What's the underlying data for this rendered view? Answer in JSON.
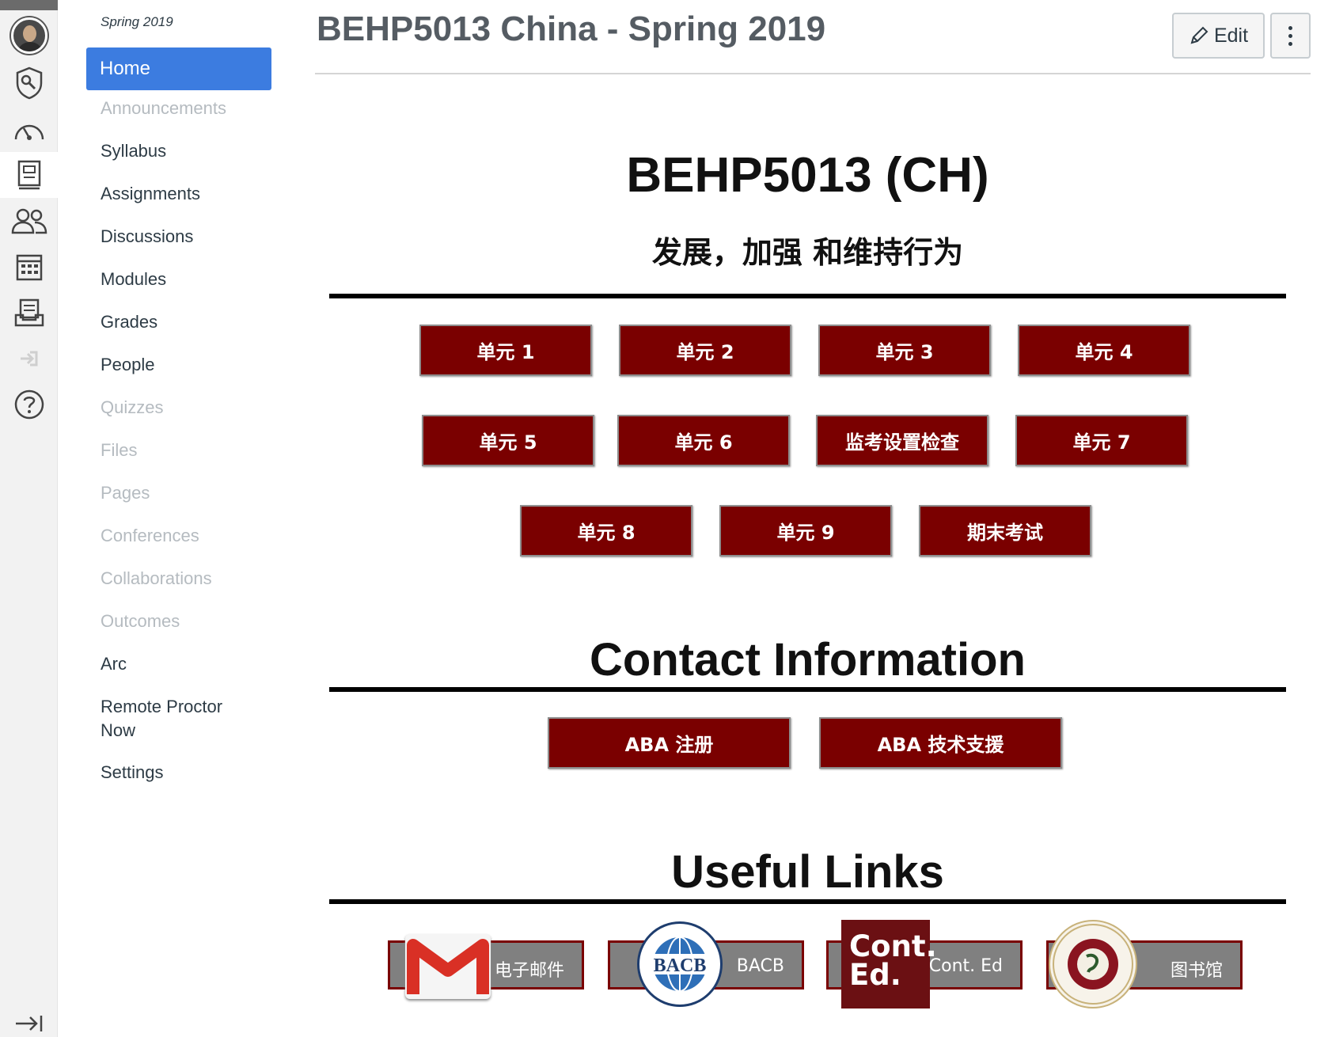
{
  "global_nav": {
    "items": [
      {
        "name": "account",
        "icon": "avatar"
      },
      {
        "name": "admin",
        "icon": "shield-wrench-icon"
      },
      {
        "name": "dashboard",
        "icon": "speedometer-icon"
      },
      {
        "name": "courses",
        "icon": "book-icon",
        "active": true
      },
      {
        "name": "groups",
        "icon": "people-icon"
      },
      {
        "name": "calendar",
        "icon": "calendar-icon"
      },
      {
        "name": "inbox",
        "icon": "inbox-icon"
      },
      {
        "name": "commons",
        "icon": "arrow-out-icon"
      },
      {
        "name": "help",
        "icon": "help-circle-icon"
      }
    ],
    "collapse_icon": "collapse-arrow-icon"
  },
  "course_nav": {
    "term": "Spring 2019",
    "home": "Home",
    "items": [
      {
        "label": "Announcements",
        "disabled": true
      },
      {
        "label": "Syllabus",
        "disabled": false
      },
      {
        "label": "Assignments",
        "disabled": false
      },
      {
        "label": "Discussions",
        "disabled": false
      },
      {
        "label": "Modules",
        "disabled": false
      },
      {
        "label": "Grades",
        "disabled": false
      },
      {
        "label": "People",
        "disabled": false
      },
      {
        "label": "Quizzes",
        "disabled": true
      },
      {
        "label": "Files",
        "disabled": true
      },
      {
        "label": "Pages",
        "disabled": true
      },
      {
        "label": "Conferences",
        "disabled": true
      },
      {
        "label": "Collaborations",
        "disabled": true
      },
      {
        "label": "Outcomes",
        "disabled": true
      },
      {
        "label": "Arc",
        "disabled": false
      },
      {
        "label": "Remote Proctor\nNow",
        "disabled": false
      },
      {
        "label": "Settings",
        "disabled": false
      }
    ]
  },
  "header": {
    "title": "BEHP5013 China - Spring 2019",
    "edit_label": "Edit"
  },
  "main": {
    "course_code": "BEHP5013 (CH)",
    "course_subtitle": "发展，加强 和维持行为",
    "unit_buttons": [
      "单元 1",
      "单元 2",
      "单元 3",
      "单元 4",
      "单元 5",
      "单元 6",
      "监考设置检查",
      "单元 7",
      "单元 8",
      "单元 9",
      "期末考试"
    ],
    "contact_title": "Contact Information",
    "contact_buttons": [
      "ABA 注册",
      "ABA 技术支援"
    ],
    "links_title": "Useful Links",
    "links": [
      {
        "label": "电子邮件",
        "logo": "gmail-logo"
      },
      {
        "label": "BACB",
        "logo": "bacb-logo"
      },
      {
        "label": "Cont. Ed",
        "logo": "cont-ed-logo"
      },
      {
        "label": "图书馆",
        "logo": "florida-tech-seal"
      }
    ],
    "logo_text": {
      "bacb": "BACB",
      "cont_ed_1": "Cont.",
      "cont_ed_2": "Ed."
    }
  },
  "colors": {
    "accent": "#3c7ce0",
    "button_bg": "#7a0000",
    "link_tile_bg": "#808080"
  }
}
